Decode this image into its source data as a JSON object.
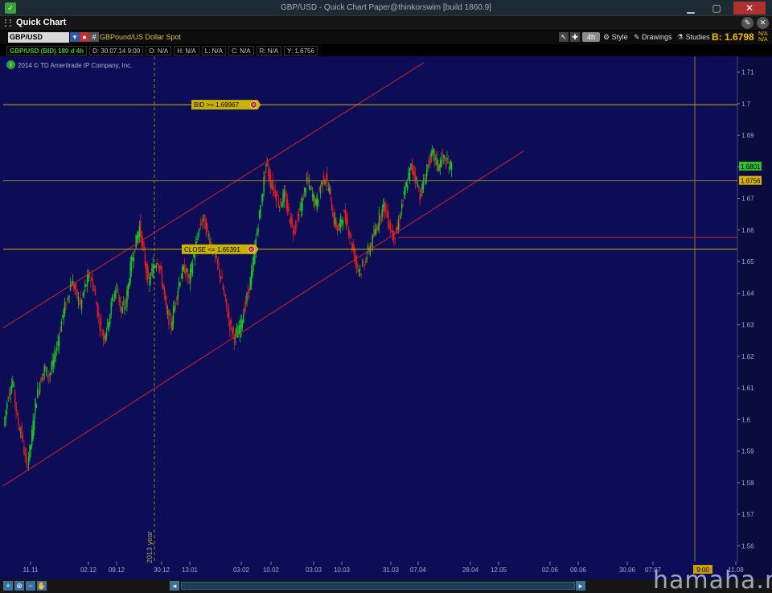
{
  "window": {
    "title": "GBP/USD - Quick Chart Paper@thinkorswim [build 1860.9]"
  },
  "header": {
    "label": "Quick Chart"
  },
  "toolbar": {
    "symbol": "GBP/USD",
    "description": "GBPound/US Dollar Spot",
    "timeframe": "4h",
    "style_label": "Style",
    "drawings_label": "Drawings",
    "studies_label": "Studies",
    "bid_price": "B: 1.6798",
    "na_top": "N/A",
    "na_bottom": "N/A"
  },
  "infobar": {
    "symbol_period": "GBP/USD (BID) 180 d 4h",
    "date": "D: 30.07.14 9:00",
    "open": "O: N/A",
    "high": "H: N/A",
    "low": "L: N/A",
    "close": "C: N/A",
    "range": "R: N/A",
    "y": "Y: 1.6756"
  },
  "copyright": "2014 © TD Ameritrade IP Company, Inc.",
  "watermark": "hamaha.net",
  "colors": {
    "background": "#0d0d57",
    "up_candle": "#22c622",
    "down_candle": "#e02020",
    "channel": "#d0202a",
    "alert_line": "#c8b400",
    "accent": "#f0c000"
  },
  "chart_data": {
    "type": "candlestick",
    "y_range": [
      1.555,
      1.715
    ],
    "y_ticks": [
      "1.71",
      "1.7",
      "1.69",
      "1.68",
      "1.67",
      "1.66",
      "1.65",
      "1.64",
      "1.63",
      "1.62",
      "1.61",
      "1.6",
      "1.59",
      "1.58",
      "1.57",
      "1.56"
    ],
    "x_labels": [
      "11.11",
      "02.12",
      "09.12",
      "30.12",
      "13.01",
      "03.02",
      "10.02",
      "03.03",
      "10.03",
      "31.03",
      "07.04",
      "28.04",
      "12.05",
      "02.06",
      "09.06",
      "30.06",
      "07.07",
      "11.08"
    ],
    "year_marker": "2013 year",
    "time_marker": "9:00",
    "alerts": [
      {
        "label": "BID >= 1.69967",
        "value": 1.69967
      },
      {
        "label": "CLOSE <= 1.65391",
        "value": 1.65391
      }
    ],
    "price_tags": [
      {
        "label": "1.6801",
        "value": 1.6801,
        "kind": "bid"
      },
      {
        "label": "1.6756",
        "value": 1.6756,
        "kind": "cursor"
      }
    ],
    "channel_lines": [
      {
        "x": [
          "11.11",
          "07.04"
        ],
        "y": [
          1.629,
          1.713
        ]
      },
      {
        "x": [
          "11.11",
          "28.04"
        ],
        "y": [
          1.579,
          1.685
        ]
      }
    ],
    "support_level": 1.6576,
    "price_path": [
      [
        0,
        1.598
      ],
      [
        4,
        1.608
      ],
      [
        8,
        1.612
      ],
      [
        12,
        1.6
      ],
      [
        16,
        1.595
      ],
      [
        20,
        1.585
      ],
      [
        24,
        1.592
      ],
      [
        28,
        1.605
      ],
      [
        32,
        1.612
      ],
      [
        36,
        1.616
      ],
      [
        40,
        1.614
      ],
      [
        44,
        1.618
      ],
      [
        48,
        1.625
      ],
      [
        52,
        1.633
      ],
      [
        56,
        1.638
      ],
      [
        60,
        1.644
      ],
      [
        64,
        1.64
      ],
      [
        68,
        1.636
      ],
      [
        72,
        1.642
      ],
      [
        76,
        1.646
      ],
      [
        80,
        1.641
      ],
      [
        84,
        1.632
      ],
      [
        88,
        1.626
      ],
      [
        92,
        1.63
      ],
      [
        96,
        1.638
      ],
      [
        100,
        1.642
      ],
      [
        104,
        1.634
      ],
      [
        108,
        1.637
      ],
      [
        112,
        1.648
      ],
      [
        116,
        1.655
      ],
      [
        120,
        1.661
      ],
      [
        124,
        1.652
      ],
      [
        128,
        1.643
      ],
      [
        132,
        1.648
      ],
      [
        136,
        1.651
      ],
      [
        140,
        1.644
      ],
      [
        144,
        1.634
      ],
      [
        148,
        1.63
      ],
      [
        152,
        1.638
      ],
      [
        156,
        1.645
      ],
      [
        160,
        1.648
      ],
      [
        164,
        1.644
      ],
      [
        168,
        1.652
      ],
      [
        172,
        1.659
      ],
      [
        176,
        1.664
      ],
      [
        180,
        1.659
      ],
      [
        184,
        1.655
      ],
      [
        188,
        1.65
      ],
      [
        192,
        1.645
      ],
      [
        196,
        1.637
      ],
      [
        200,
        1.63
      ],
      [
        204,
        1.626
      ],
      [
        208,
        1.628
      ],
      [
        212,
        1.634
      ],
      [
        216,
        1.64
      ],
      [
        220,
        1.648
      ],
      [
        224,
        1.66
      ],
      [
        228,
        1.67
      ],
      [
        232,
        1.681
      ],
      [
        236,
        1.675
      ],
      [
        240,
        1.672
      ],
      [
        244,
        1.668
      ],
      [
        248,
        1.671
      ],
      [
        252,
        1.665
      ],
      [
        256,
        1.66
      ],
      [
        260,
        1.664
      ],
      [
        264,
        1.669
      ],
      [
        268,
        1.676
      ],
      [
        272,
        1.672
      ],
      [
        276,
        1.668
      ],
      [
        280,
        1.674
      ],
      [
        284,
        1.677
      ],
      [
        288,
        1.672
      ],
      [
        292,
        1.663
      ],
      [
        296,
        1.66
      ],
      [
        300,
        1.665
      ],
      [
        304,
        1.662
      ],
      [
        308,
        1.655
      ],
      [
        312,
        1.649
      ],
      [
        316,
        1.647
      ],
      [
        320,
        1.651
      ],
      [
        324,
        1.655
      ],
      [
        328,
        1.659
      ],
      [
        332,
        1.664
      ],
      [
        336,
        1.668
      ],
      [
        340,
        1.663
      ],
      [
        344,
        1.658
      ],
      [
        348,
        1.66
      ],
      [
        352,
        1.668
      ],
      [
        356,
        1.674
      ],
      [
        360,
        1.68
      ],
      [
        364,
        1.677
      ],
      [
        368,
        1.671
      ],
      [
        372,
        1.676
      ],
      [
        376,
        1.682
      ],
      [
        380,
        1.684
      ],
      [
        384,
        1.68
      ],
      [
        388,
        1.683
      ],
      [
        392,
        1.681
      ],
      [
        396,
        1.68
      ]
    ],
    "price_path_note": "",
    "grid": false
  }
}
